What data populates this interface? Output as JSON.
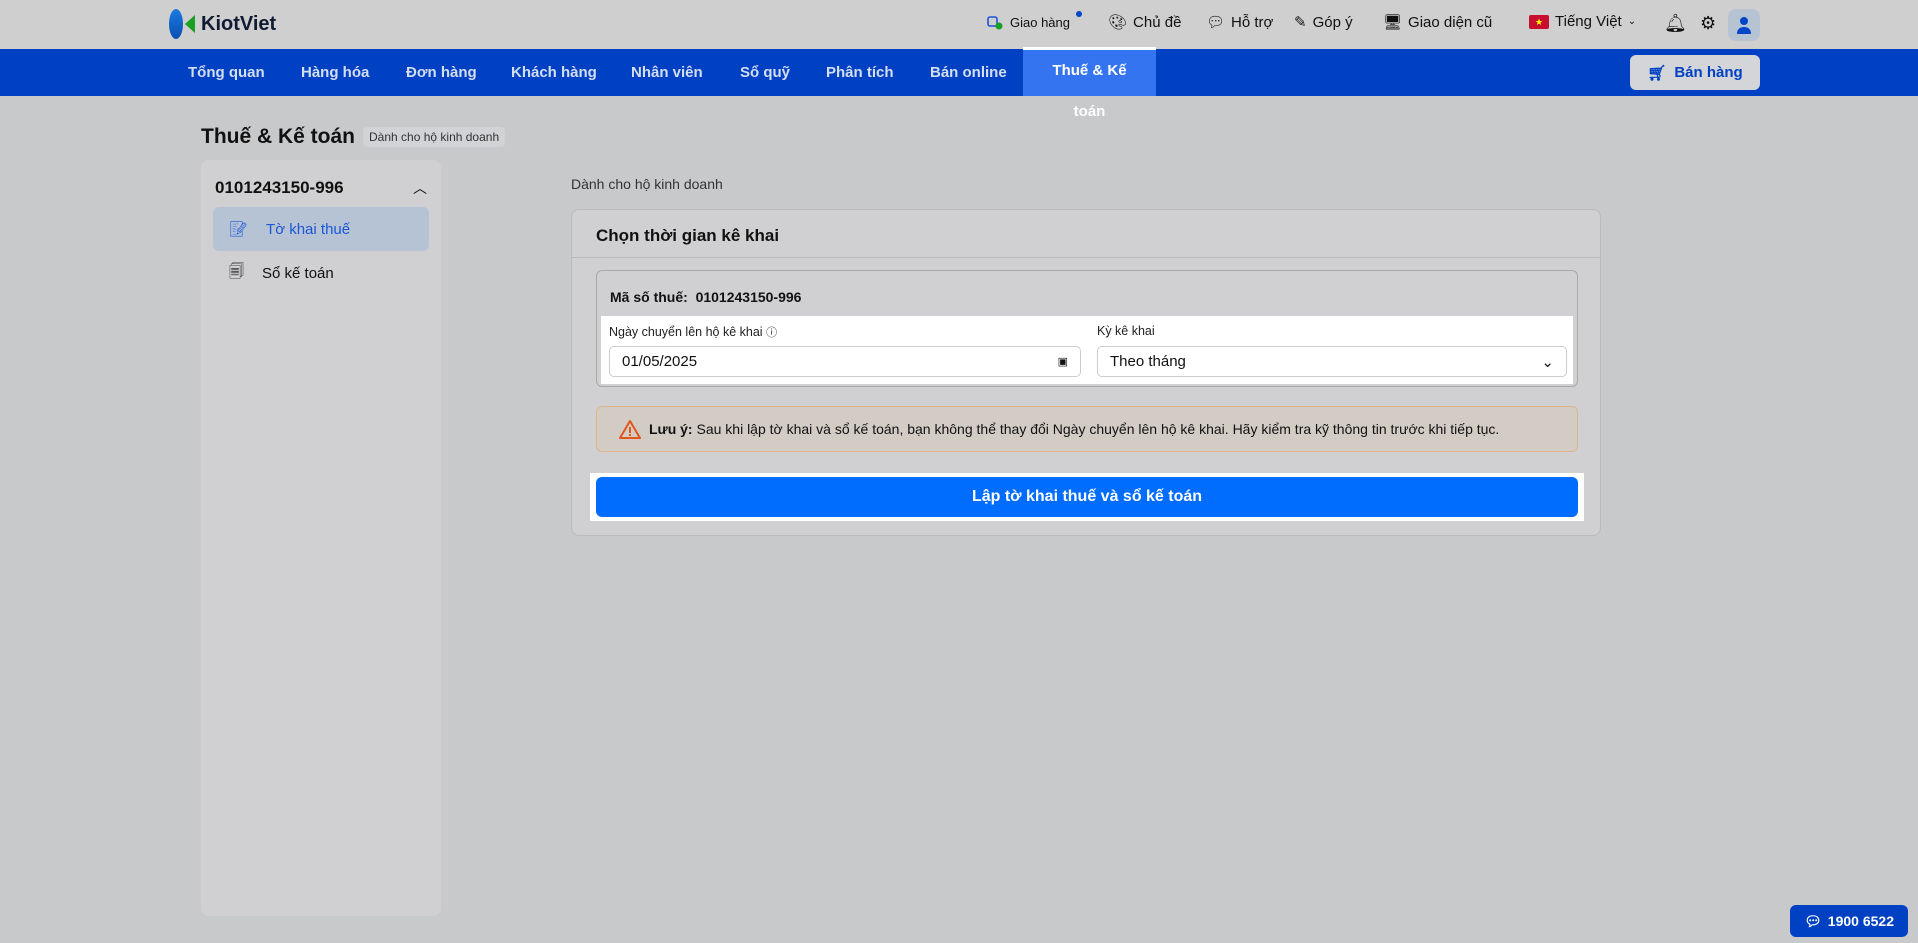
{
  "header": {
    "logo": "KiotViet",
    "delivery": "Giao hàng",
    "theme": "Chủ đề",
    "support": "Hỗ trợ",
    "feedback": "Góp ý",
    "old_ui": "Giao diện cũ",
    "language": "Tiếng Việt"
  },
  "nav": {
    "items": [
      "Tổng quan",
      "Hàng hóa",
      "Đơn hàng",
      "Khách hàng",
      "Nhân viên",
      "Sổ quỹ",
      "Phân tích",
      "Bán online",
      "Thuế & Kế toán"
    ],
    "sell": "Bán hàng"
  },
  "page": {
    "title": "Thuế & Kế toán",
    "badge": "Dành cho hộ kinh doanh"
  },
  "sidebar": {
    "account": "0101243150-996",
    "items": [
      {
        "label": "Tờ khai thuế"
      },
      {
        "label": "Sổ kế toán"
      }
    ]
  },
  "main": {
    "breadcrumb": "Dành cho hộ kinh doanh",
    "card_title": "Chọn thời gian kê khai",
    "tax_label": "Mã số thuế:",
    "tax_value": "0101243150-996",
    "date_label": "Ngày chuyển lên hộ kê khai",
    "date_value": "01/05/2025",
    "period_label": "Kỳ kê khai",
    "period_value": "Theo tháng",
    "warn_bold": "Lưu ý:",
    "warn_text": "Sau khi lập tờ khai và sổ kế toán, bạn không thể thay đổi Ngày chuyển lên hộ kê khai. Hãy kiểm tra kỹ thông tin trước khi tiếp tục.",
    "submit": "Lập tờ khai thuế và sổ kế toán"
  },
  "hotline": "1900 6522"
}
